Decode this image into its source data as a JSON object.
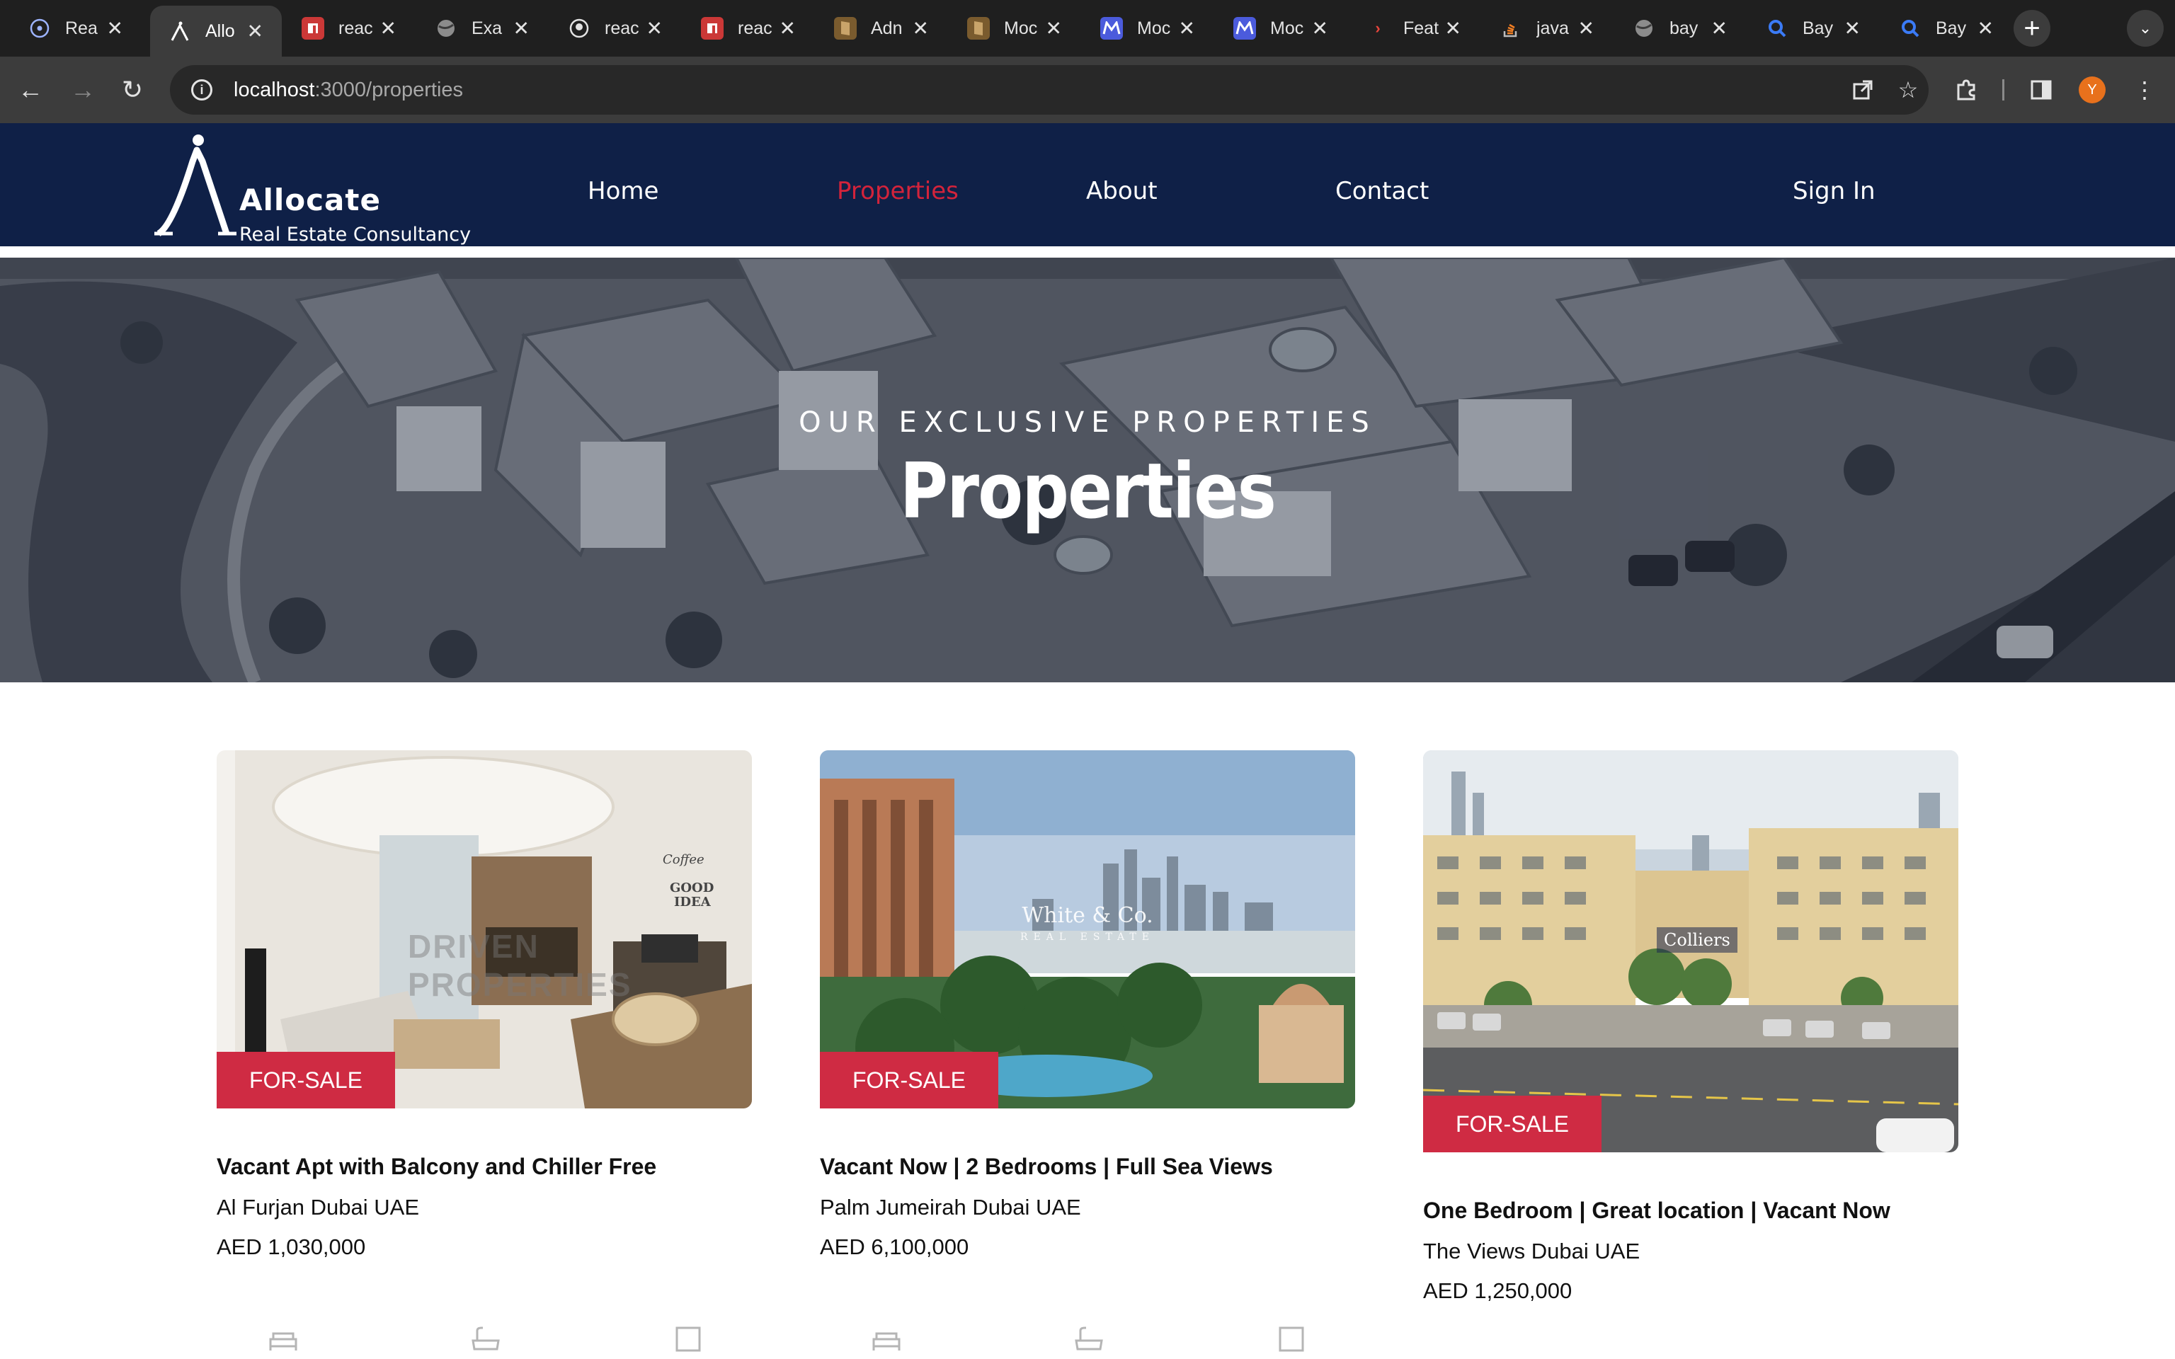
{
  "browser": {
    "tabs": [
      {
        "title": "Rea",
        "icon": "react-icon",
        "color": "#1f1f1f"
      },
      {
        "title": "Allo",
        "icon": "allocate-icon",
        "color": "#1f1f1f",
        "active": true
      },
      {
        "title": "reac",
        "icon": "npm-icon",
        "color": "#cb3837"
      },
      {
        "title": "Exa",
        "icon": "globe-icon",
        "color": "#1f1f1f"
      },
      {
        "title": "reac",
        "icon": "github-icon",
        "color": "#1f1f1f"
      },
      {
        "title": "reac",
        "icon": "npm-icon",
        "color": "#cb3837"
      },
      {
        "title": "Adn",
        "icon": "docs-icon",
        "color": "#7a5b2e"
      },
      {
        "title": "Moc",
        "icon": "docs-icon",
        "color": "#7a5b2e"
      },
      {
        "title": "Moc",
        "icon": "mockapi-icon",
        "color": "#4b5bdc"
      },
      {
        "title": "Moc",
        "icon": "mockapi-icon",
        "color": "#4b5bdc"
      },
      {
        "title": "Feat",
        "icon": "chevron-icon",
        "color": "#1f1f1f"
      },
      {
        "title": "java",
        "icon": "stackoverflow-icon",
        "color": "#1f1f1f"
      },
      {
        "title": "bay",
        "icon": "globe-icon",
        "color": "#1f1f1f"
      },
      {
        "title": "Bay",
        "icon": "search-q-icon",
        "color": "#1f1f1f"
      },
      {
        "title": "Bay",
        "icon": "search-q-icon",
        "color": "#1f1f1f"
      }
    ],
    "url_host": "localhost",
    "url_rest": ":3000/properties",
    "profile_initial": "Y"
  },
  "site": {
    "logo_name": "Allocate",
    "logo_sub": "Real Estate Consultancy",
    "nav": [
      {
        "label": "Home"
      },
      {
        "label": "Properties",
        "active": true
      },
      {
        "label": "About"
      },
      {
        "label": "Contact"
      }
    ],
    "sign_in": "Sign In",
    "accent": "#d3233b",
    "navy": "#0f2047"
  },
  "hero": {
    "kicker": "OUR EXCLUSIVE PROPERTIES",
    "title": "Properties"
  },
  "listings": [
    {
      "badge": "FOR-SALE",
      "title": "Vacant Apt with Balcony and Chiller Free",
      "location": "Al Furjan Dubai UAE",
      "price": "AED 1,030,000",
      "watermark": "DRIVEN PROPERTIES"
    },
    {
      "badge": "FOR-SALE",
      "title": "Vacant Now | 2 Bedrooms | Full Sea Views",
      "location": "Palm Jumeirah Dubai UAE",
      "price": "AED 6,100,000",
      "watermark": "White & Co.",
      "watermark_sub": "REAL ESTATE"
    },
    {
      "badge": "FOR-SALE",
      "title": "One Bedroom | Great location | Vacant Now",
      "location": "The Views Dubai UAE",
      "price": "AED 1,250,000",
      "watermark": "Colliers"
    }
  ]
}
